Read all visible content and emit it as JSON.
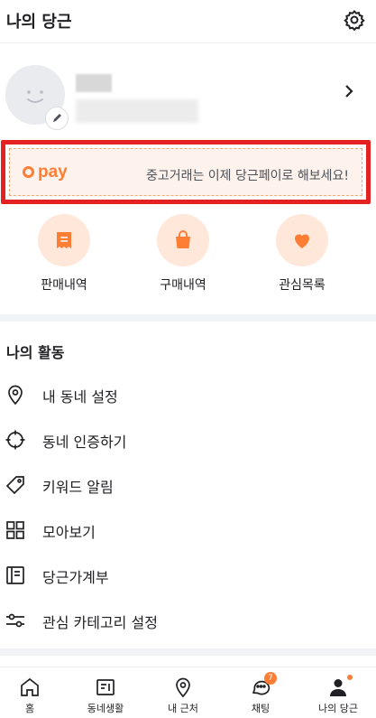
{
  "header": {
    "title": "나의 당근",
    "settings_icon": "gear-icon"
  },
  "pay_banner": {
    "logo_text": "pay",
    "message": "중고거래는 이제 당근페이로 해보세요!",
    "accent": "#ff7e36",
    "highlight_border": "#e52222"
  },
  "quick_actions": [
    {
      "label": "판매내역",
      "icon": "receipt-icon"
    },
    {
      "label": "구매내역",
      "icon": "shopping-bag-icon"
    },
    {
      "label": "관심목록",
      "icon": "heart-icon"
    }
  ],
  "activity": {
    "title": "나의 활동",
    "items": [
      {
        "label": "내 동네 설정",
        "icon": "location-pin-icon"
      },
      {
        "label": "동네 인증하기",
        "icon": "crosshair-icon"
      },
      {
        "label": "키워드 알림",
        "icon": "tag-icon"
      },
      {
        "label": "모아보기",
        "icon": "grid-icon"
      },
      {
        "label": "당근가계부",
        "icon": "ledger-icon"
      },
      {
        "label": "관심 카테고리 설정",
        "icon": "sliders-icon"
      }
    ]
  },
  "tabbar": {
    "tabs": [
      {
        "label": "홈",
        "icon": "home-icon"
      },
      {
        "label": "동네생활",
        "icon": "board-icon"
      },
      {
        "label": "내 근처",
        "icon": "location-pin-icon"
      },
      {
        "label": "채팅",
        "icon": "chat-icon",
        "badge": "7"
      },
      {
        "label": "나의 당근",
        "icon": "person-icon",
        "active": true
      }
    ]
  }
}
